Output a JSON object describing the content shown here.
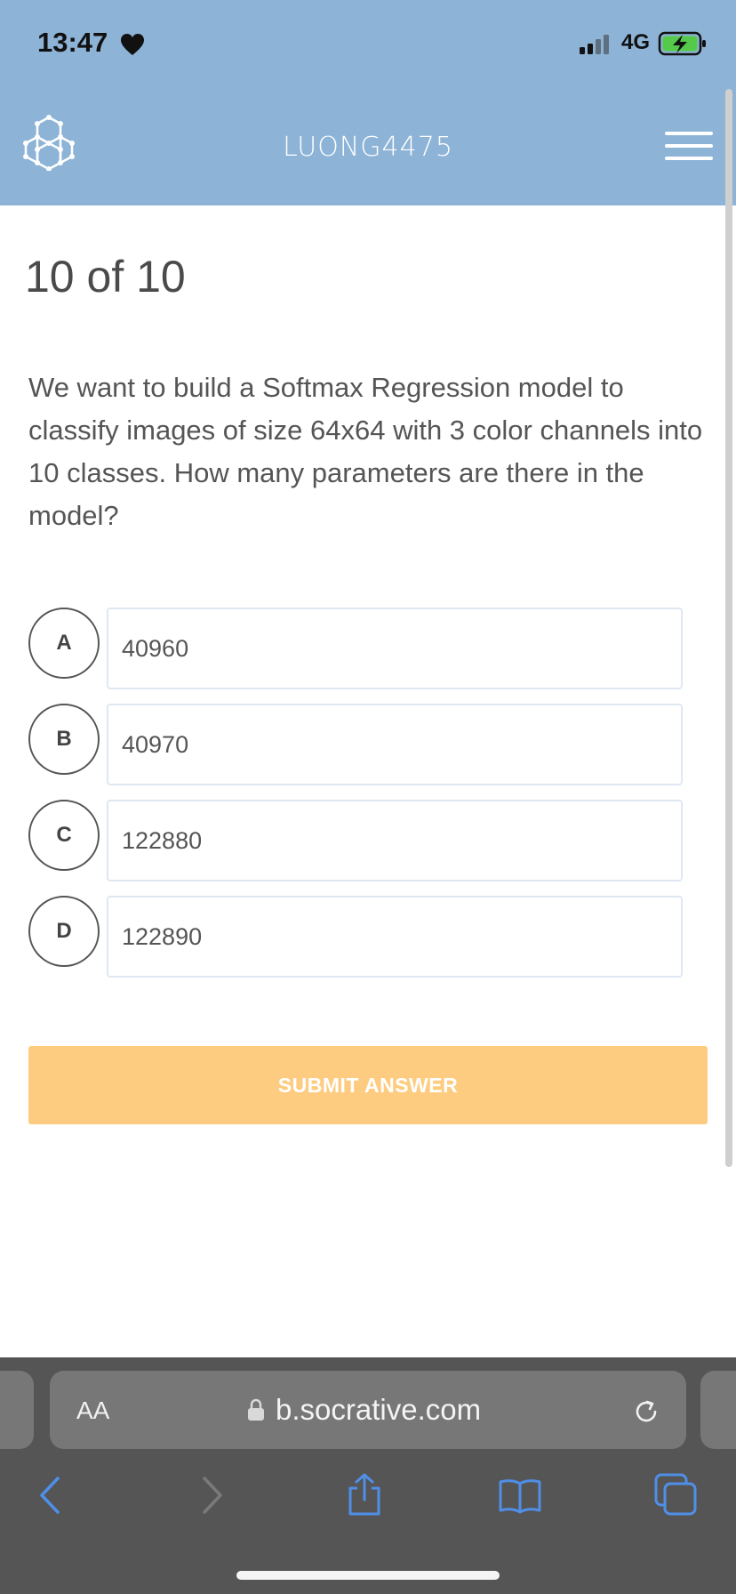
{
  "status_bar": {
    "time": "13:47",
    "network": "4G"
  },
  "header": {
    "class_name": "LUONG4475",
    "colors": {
      "bar": "#8db3d6"
    }
  },
  "quiz": {
    "progress": "10 of 10",
    "question": "We want to build a Softmax Regression model to classify images of size 64x64 with 3 color channels into 10 classes. How many parameters are there in the model?",
    "options": [
      {
        "letter": "A",
        "text": "40960"
      },
      {
        "letter": "B",
        "text": "40970"
      },
      {
        "letter": "C",
        "text": "122880"
      },
      {
        "letter": "D",
        "text": "122890"
      }
    ],
    "submit_label": "SUBMIT ANSWER",
    "colors": {
      "submit": "#fdcc80",
      "option_border": "#dfe8f2"
    }
  },
  "browser": {
    "text_size_label": "AA",
    "url": "b.socrative.com",
    "toolbar_icons": [
      "back-icon",
      "forward-icon",
      "share-icon",
      "bookmarks-icon",
      "tabs-icon"
    ],
    "colors": {
      "accent": "#4f8fe8"
    }
  }
}
